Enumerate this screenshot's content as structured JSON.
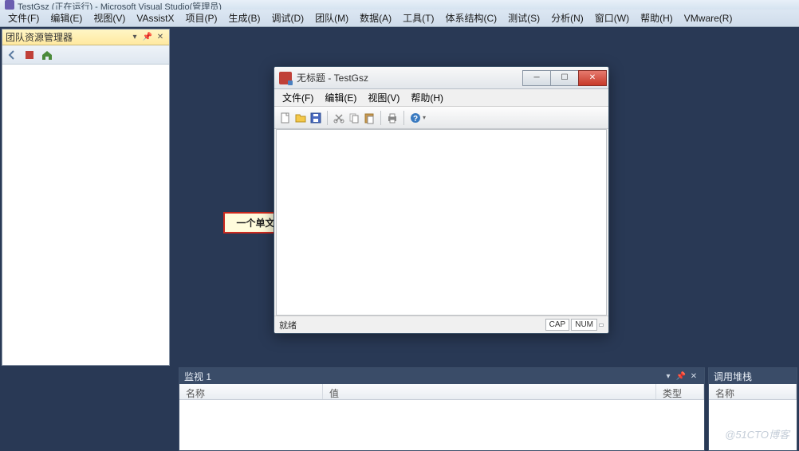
{
  "vs": {
    "title": "TestGsz (正在运行) - Microsoft Visual Studio(管理员)",
    "menu": [
      "文件(F)",
      "编辑(E)",
      "视图(V)",
      "VAssistX",
      "项目(P)",
      "生成(B)",
      "调试(D)",
      "团队(M)",
      "数据(A)",
      "工具(T)",
      "体系结构(C)",
      "测试(S)",
      "分析(N)",
      "窗口(W)",
      "帮助(H)",
      "VMware(R)"
    ]
  },
  "teamExplorer": {
    "title": "团队资源管理器"
  },
  "mfc": {
    "title": "无标题 - TestGsz",
    "menu": [
      "文件(F)",
      "编辑(E)",
      "视图(V)",
      "帮助(H)"
    ],
    "status_ready": "就绪",
    "status_cap": "CAP",
    "status_num": "NUM"
  },
  "callout": {
    "text": "一个单文档MFC程序。"
  },
  "watch": {
    "title": "监视 1",
    "columns": [
      "名称",
      "值",
      "类型"
    ]
  },
  "callstack": {
    "title": "调用堆栈",
    "columns": [
      "名称"
    ]
  },
  "watermark": "@51CTO博客"
}
